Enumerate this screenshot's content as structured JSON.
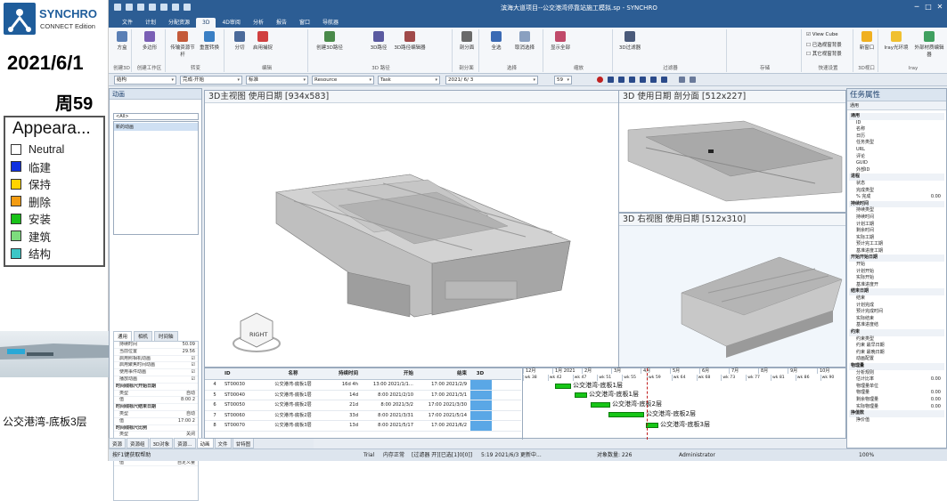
{
  "overlay": {
    "logo_title": "SYNCHRO",
    "logo_subtitle": "CONNECT Edition",
    "date": "2021/6/1",
    "week": "周59",
    "legend_title": "Appeara...",
    "legend": [
      {
        "label": "Neutral",
        "color": "#ffffff"
      },
      {
        "label": "临建",
        "color": "#1030e0"
      },
      {
        "label": "保持",
        "color": "#ffd400"
      },
      {
        "label": "删除",
        "color": "#f39c12"
      },
      {
        "label": "安装",
        "color": "#19c219"
      },
      {
        "label": "建筑",
        "color": "#7ddc7d"
      },
      {
        "label": "结构",
        "color": "#3cc6c6"
      }
    ],
    "thumbnail_caption": "公交港湾-底板3层"
  },
  "window": {
    "title": "滨海大道项目--公交港湾停靠站施工模拟.sp - SYNCHRO",
    "menu": [
      "文件",
      "计划",
      "分配资源",
      "3D",
      "4D审阅",
      "分析",
      "报告",
      "窗口",
      "导航器"
    ],
    "active_menu": "3D"
  },
  "ribbon": {
    "groups": [
      {
        "label": "创建3D",
        "buttons": [
          "方盒"
        ]
      },
      {
        "label": "创建工作区",
        "buttons": [
          "多边形"
        ]
      },
      {
        "label": "转变",
        "buttons": [
          "传输资源节杆",
          "重置转换"
        ]
      },
      {
        "label": "编辑",
        "buttons": [
          "分切",
          "启用捕捉"
        ]
      },
      {
        "label": "3D 路径",
        "buttons": [
          "创建3D路径",
          "3D路径",
          "3D路径编辑器"
        ]
      },
      {
        "label": "剖分面",
        "buttons": [
          "剖分面"
        ]
      },
      {
        "label": "选择",
        "buttons": [
          "全选",
          "取消选择"
        ]
      },
      {
        "label": "缩放",
        "buttons": [
          "显示全部"
        ]
      },
      {
        "label": "过滤器",
        "buttons": [
          "3D过滤器"
        ]
      },
      {
        "label": "存储",
        "buttons": []
      },
      {
        "label": "快速设置",
        "buttons": [
          "View Cube",
          "已选视窗背景",
          "其它视窗背景"
        ]
      },
      {
        "label": "3D视口",
        "buttons": [
          "新窗口"
        ]
      },
      {
        "label": "Iray",
        "buttons": [
          "Iray光环境",
          "外部材质编辑器"
        ]
      }
    ]
  },
  "toolbar2": {
    "combo1": "结构",
    "combo2": "完成-开始",
    "combo3": "标准",
    "combo4": "Resource",
    "combo5": "Task",
    "date_value": "2021/ 6/ 3",
    "spin_value": "59"
  },
  "anim_pane": {
    "title": "动画",
    "search": "<All>",
    "list_item": "新的动画",
    "tabs": [
      "通用",
      "相机",
      "时间轴"
    ],
    "props": [
      {
        "k": "持续时间",
        "v": "50.09"
      },
      {
        "k": "当前位置",
        "v": "29.56"
      },
      {
        "k": "启用照相机动画",
        "v": "☑"
      },
      {
        "k": "启用聚焦时间动画",
        "v": "☑"
      },
      {
        "k": "使用事件动画",
        "v": "☑"
      },
      {
        "k": "播放动画",
        "v": "☑"
      },
      {
        "k": "时间线标尺开始日期",
        "v": "",
        "sec": true
      },
      {
        "k": "类型",
        "v": "自动"
      },
      {
        "k": "值",
        "v": "8:00 2"
      },
      {
        "k": "时间线标尺结束日期",
        "v": "",
        "sec": true
      },
      {
        "k": "类型",
        "v": "自动"
      },
      {
        "k": "值",
        "v": "17:00 2"
      },
      {
        "k": "时间线标尺比例",
        "v": "",
        "sec": true
      },
      {
        "k": "类型",
        "v": "关闭"
      },
      {
        "k": "值",
        "v": "自动"
      },
      {
        "k": "聚焦时间位置",
        "v": "",
        "sec": true
      },
      {
        "k": "类型",
        "v": "自动"
      },
      {
        "k": "值",
        "v": "自定义量"
      }
    ]
  },
  "bottom_tabs": [
    "资源",
    "资源组",
    "3D对象",
    "资源...",
    "动画",
    "文件",
    "甘特图"
  ],
  "viewports": {
    "main": "3D主视图 使用日期 [934x583]",
    "section": "3D 使用日期 剖分面 [512x227]",
    "right": "3D 右视图 使用日期 [512x310]",
    "cube_label": "RIGHT"
  },
  "gantt": {
    "headers": [
      "ID",
      "名称",
      "持续时间",
      "开始",
      "结束",
      "3D"
    ],
    "rows": [
      {
        "n": "4",
        "id": "ST00030",
        "name": "公交港湾-底板1层",
        "dur": "16d 4h",
        "start": "13:00 2021/1/1…",
        "end": "17:00 2021/2/9"
      },
      {
        "n": "5",
        "id": "ST00040",
        "name": "公交港湾-底板1层",
        "dur": "14d",
        "start": "8:00 2021/2/10",
        "end": "17:00 2021/3/1"
      },
      {
        "n": "6",
        "id": "ST00050",
        "name": "公交港湾-底板2层",
        "dur": "21d",
        "start": "8:00 2021/3/2",
        "end": "17:00 2021/3/30"
      },
      {
        "n": "7",
        "id": "ST00060",
        "name": "公交港湾-底板2层",
        "dur": "33d",
        "start": "8:00 2021/3/31",
        "end": "17:00 2021/5/14"
      },
      {
        "n": "8",
        "id": "ST00070",
        "name": "公交港湾-底板3层",
        "dur": "13d",
        "start": "8:00 2021/5/17",
        "end": "17:00 2021/6/2"
      }
    ],
    "months": [
      "12月",
      "1月 2021",
      "2月",
      "3月",
      "4月",
      "5月",
      "6月",
      "7月",
      "8月",
      "9月",
      "10月"
    ],
    "weeks": [
      "wk 38",
      "wk 42",
      "wk 47",
      "wk 51",
      "wk 55",
      "wk 59",
      "wk 64",
      "wk 68",
      "wk 73",
      "wk 77",
      "wk 81",
      "wk 86",
      "wk 90"
    ],
    "bar_labels": [
      "公交港湾-底板1层",
      "公交港湾-底板1层",
      "公交港湾-底板2层",
      "公交港湾-底板2层",
      "公交港湾-底板3层"
    ]
  },
  "task_pane": {
    "title": "任务属性",
    "tool": "通用",
    "props": [
      {
        "k": "通用",
        "sec": true
      },
      {
        "k": "ID"
      },
      {
        "k": "名称"
      },
      {
        "k": "日历"
      },
      {
        "k": "任务类型"
      },
      {
        "k": "URL"
      },
      {
        "k": "评论"
      },
      {
        "k": "GUID"
      },
      {
        "k": "外部ID"
      },
      {
        "k": "进程",
        "sec": true
      },
      {
        "k": "状态"
      },
      {
        "k": "完成类型"
      },
      {
        "k": "% 完成",
        "v": "0.00"
      },
      {
        "k": "持续时间",
        "sec": true
      },
      {
        "k": "持续类型"
      },
      {
        "k": "持续时间"
      },
      {
        "k": "计划工期"
      },
      {
        "k": "剩余时间"
      },
      {
        "k": "实际工期"
      },
      {
        "k": "预计完工工期"
      },
      {
        "k": "基准进度工期"
      },
      {
        "k": "开始开始日期",
        "sec": true
      },
      {
        "k": "开始"
      },
      {
        "k": "计划开始"
      },
      {
        "k": "实际开始"
      },
      {
        "k": "基准进度开"
      },
      {
        "k": "结束日期",
        "sec": true
      },
      {
        "k": "结束"
      },
      {
        "k": "计划完成"
      },
      {
        "k": "预计完成时间"
      },
      {
        "k": "实际结束"
      },
      {
        "k": "基准进度结"
      },
      {
        "k": "约束",
        "sec": true
      },
      {
        "k": "约束类型"
      },
      {
        "k": "约束 最早日期"
      },
      {
        "k": "约束 最晚日期"
      },
      {
        "k": "动画配置"
      },
      {
        "k": "物理量",
        "sec": true
      },
      {
        "k": "分析规则"
      },
      {
        "k": "估计比率",
        "v": "0.00"
      },
      {
        "k": "物理量单位"
      },
      {
        "k": "物理量",
        "v": "0.00"
      },
      {
        "k": "剩余物理量",
        "v": "0.00"
      },
      {
        "k": "实际物理量",
        "v": "0.00"
      },
      {
        "k": "挣值数",
        "sec": true
      },
      {
        "k": "挣价值"
      }
    ]
  },
  "status": {
    "left": "按F1键获取帮助",
    "trial": "Trial",
    "mem": "内存正常",
    "filter": "[过滤器 开][已选[1]0[0]]",
    "date": "5:19 2021/6/3",
    "update": "更新中...",
    "count": "对象数量: 226",
    "user": "Administrator",
    "zoom": "100%"
  }
}
